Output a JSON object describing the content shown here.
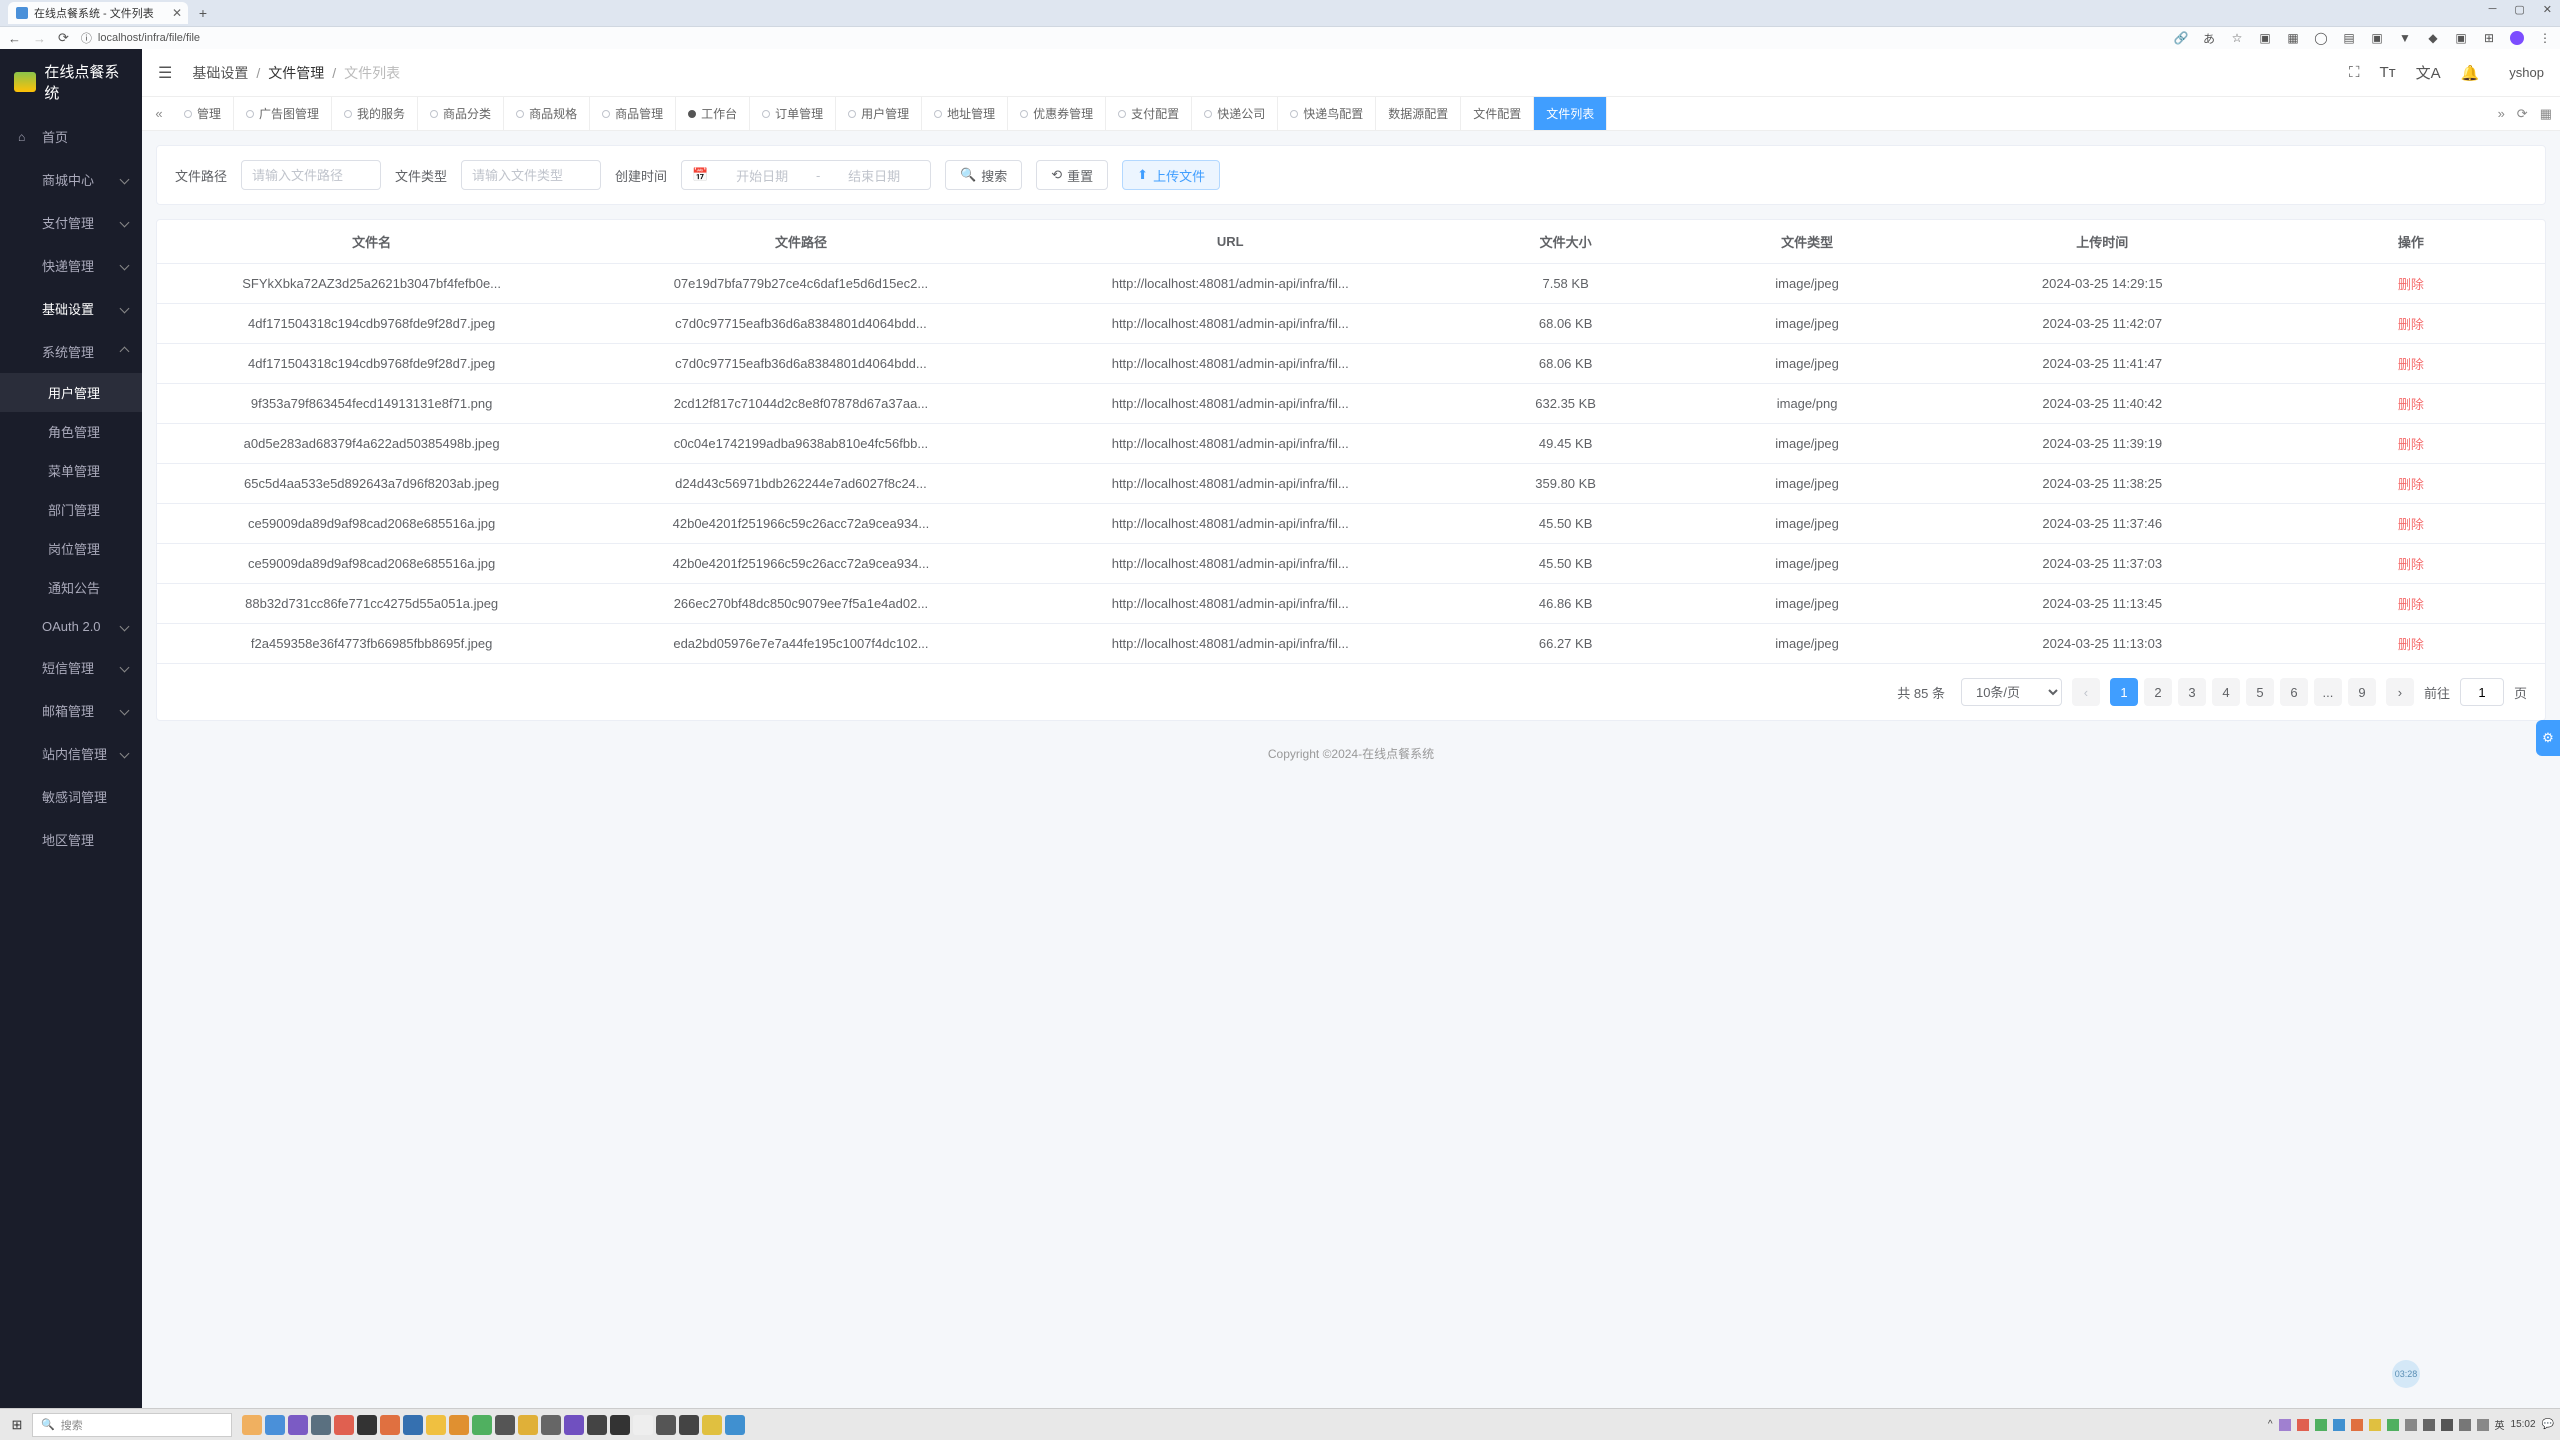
{
  "browser": {
    "tab_title": "在线点餐系统 - 文件列表",
    "url": "localhost/infra/file/file"
  },
  "app": {
    "title": "在线点餐系统",
    "user": "yshop"
  },
  "sidebar": {
    "home": "首页",
    "items": [
      {
        "label": "商城中心",
        "sub": false
      },
      {
        "label": "支付管理",
        "sub": false
      },
      {
        "label": "快递管理",
        "sub": false
      },
      {
        "label": "基础设置",
        "sub": false
      },
      {
        "label": "系统管理",
        "sub": true
      }
    ],
    "sys_sub": [
      "用户管理",
      "角色管理",
      "菜单管理",
      "部门管理",
      "岗位管理",
      "通知公告"
    ],
    "rest": [
      {
        "label": "OAuth 2.0"
      },
      {
        "label": "短信管理"
      },
      {
        "label": "邮箱管理"
      },
      {
        "label": "站内信管理"
      },
      {
        "label": "敏感词管理"
      },
      {
        "label": "地区管理"
      }
    ]
  },
  "crumbs": [
    "基础设置",
    "文件管理",
    "文件列表"
  ],
  "tabs": [
    "管理",
    "广告图管理",
    "我的服务",
    "商品分类",
    "商品规格",
    "商品管理",
    "工作台",
    "订单管理",
    "用户管理",
    "地址管理",
    "优惠券管理",
    "支付配置",
    "快递公司",
    "快递鸟配置",
    "数据源配置",
    "文件配置",
    "文件列表"
  ],
  "filter": {
    "path_label": "文件路径",
    "path_ph": "请输入文件路径",
    "type_label": "文件类型",
    "type_ph": "请输入文件类型",
    "date_label": "创建时间",
    "date_start_ph": "开始日期",
    "date_end_ph": "结束日期",
    "search": "搜索",
    "reset": "重置",
    "upload": "上传文件"
  },
  "table": {
    "headers": [
      "文件名",
      "文件路径",
      "URL",
      "文件大小",
      "文件类型",
      "上传时间",
      "操作"
    ],
    "delete_label": "删除",
    "rows": [
      {
        "name": "SFYkXbka72AZ3d25a2621b3047bf4fefb0e...",
        "path": "07e19d7bfa779b27ce4c6daf1e5d6d15ec2...",
        "url": "http://localhost:48081/admin-api/infra/fil...",
        "size": "7.58 KB",
        "type": "image/jpeg",
        "time": "2024-03-25 14:29:15"
      },
      {
        "name": "4df171504318c194cdb9768fde9f28d7.jpeg",
        "path": "c7d0c97715eafb36d6a8384801d4064bdd...",
        "url": "http://localhost:48081/admin-api/infra/fil...",
        "size": "68.06 KB",
        "type": "image/jpeg",
        "time": "2024-03-25 11:42:07"
      },
      {
        "name": "4df171504318c194cdb9768fde9f28d7.jpeg",
        "path": "c7d0c97715eafb36d6a8384801d4064bdd...",
        "url": "http://localhost:48081/admin-api/infra/fil...",
        "size": "68.06 KB",
        "type": "image/jpeg",
        "time": "2024-03-25 11:41:47"
      },
      {
        "name": "9f353a79f863454fecd14913131e8f71.png",
        "path": "2cd12f817c71044d2c8e8f07878d67a37aa...",
        "url": "http://localhost:48081/admin-api/infra/fil...",
        "size": "632.35 KB",
        "type": "image/png",
        "time": "2024-03-25 11:40:42"
      },
      {
        "name": "a0d5e283ad68379f4a622ad50385498b.jpeg",
        "path": "c0c04e1742199adba9638ab810e4fc56fbb...",
        "url": "http://localhost:48081/admin-api/infra/fil...",
        "size": "49.45 KB",
        "type": "image/jpeg",
        "time": "2024-03-25 11:39:19"
      },
      {
        "name": "65c5d4aa533e5d892643a7d96f8203ab.jpeg",
        "path": "d24d43c56971bdb262244e7ad6027f8c24...",
        "url": "http://localhost:48081/admin-api/infra/fil...",
        "size": "359.80 KB",
        "type": "image/jpeg",
        "time": "2024-03-25 11:38:25"
      },
      {
        "name": "ce59009da89d9af98cad2068e685516a.jpg",
        "path": "42b0e4201f251966c59c26acc72a9cea934...",
        "url": "http://localhost:48081/admin-api/infra/fil...",
        "size": "45.50 KB",
        "type": "image/jpeg",
        "time": "2024-03-25 11:37:46"
      },
      {
        "name": "ce59009da89d9af98cad2068e685516a.jpg",
        "path": "42b0e4201f251966c59c26acc72a9cea934...",
        "url": "http://localhost:48081/admin-api/infra/fil...",
        "size": "45.50 KB",
        "type": "image/jpeg",
        "time": "2024-03-25 11:37:03"
      },
      {
        "name": "88b32d731cc86fe771cc4275d55a051a.jpeg",
        "path": "266ec270bf48dc850c9079ee7f5a1e4ad02...",
        "url": "http://localhost:48081/admin-api/infra/fil...",
        "size": "46.86 KB",
        "type": "image/jpeg",
        "time": "2024-03-25 11:13:45"
      },
      {
        "name": "f2a459358e36f4773fb66985fbb8695f.jpeg",
        "path": "eda2bd05976e7e7a44fe195c1007f4dc102...",
        "url": "http://localhost:48081/admin-api/infra/fil...",
        "size": "66.27 KB",
        "type": "image/jpeg",
        "time": "2024-03-25 11:13:03"
      }
    ]
  },
  "pager": {
    "total": "共 85 条",
    "size": "10条/页",
    "pages": [
      "1",
      "2",
      "3",
      "4",
      "5",
      "6",
      "...",
      "9"
    ],
    "goto_label": "前往",
    "goto_val": "1",
    "goto_suffix": "页"
  },
  "footer": "Copyright ©2024-在线点餐系统",
  "badge": "03:28",
  "taskbar": {
    "search_ph": "搜索",
    "time": "15:02"
  }
}
